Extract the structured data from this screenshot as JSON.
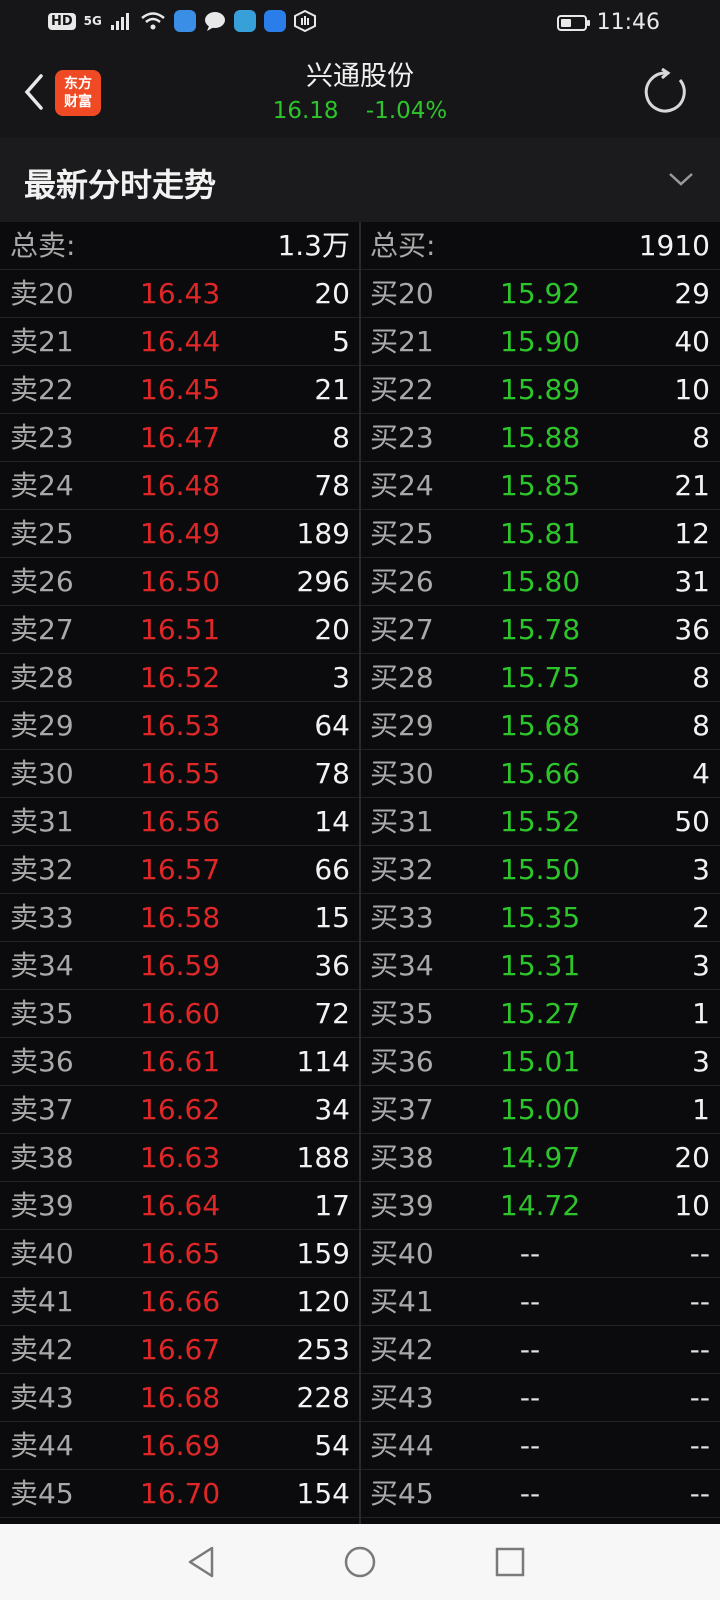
{
  "status_bar": {
    "left_tags": [
      "HD",
      "5G"
    ],
    "icons": [
      "signal-icon",
      "wifi-icon",
      "app-icon-1",
      "message-icon",
      "app-icon-2",
      "cloud-icon",
      "hand-icon"
    ],
    "battery_level": 0.45,
    "time": "11:46"
  },
  "header": {
    "logo_text_line1": "东方",
    "logo_text_line2": "财富",
    "stock_name": "兴通股份",
    "price": "16.18",
    "change": "-1.04%",
    "price_color": "#2ec42c"
  },
  "section": {
    "title": "最新分时走势"
  },
  "book": {
    "total_sell_label": "总卖:",
    "total_sell": "1.3万",
    "total_buy_label": "总买:",
    "total_buy": "1910",
    "sell_color": "#e02727",
    "buy_color": "#2ec42c",
    "rows": [
      {
        "sl": "卖20",
        "sp": "16.43",
        "sv": "20",
        "bl": "买20",
        "bp": "15.92",
        "bv": "29"
      },
      {
        "sl": "卖21",
        "sp": "16.44",
        "sv": "5",
        "bl": "买21",
        "bp": "15.90",
        "bv": "40"
      },
      {
        "sl": "卖22",
        "sp": "16.45",
        "sv": "21",
        "bl": "买22",
        "bp": "15.89",
        "bv": "10"
      },
      {
        "sl": "卖23",
        "sp": "16.47",
        "sv": "8",
        "bl": "买23",
        "bp": "15.88",
        "bv": "8"
      },
      {
        "sl": "卖24",
        "sp": "16.48",
        "sv": "78",
        "bl": "买24",
        "bp": "15.85",
        "bv": "21"
      },
      {
        "sl": "卖25",
        "sp": "16.49",
        "sv": "189",
        "bl": "买25",
        "bp": "15.81",
        "bv": "12"
      },
      {
        "sl": "卖26",
        "sp": "16.50",
        "sv": "296",
        "bl": "买26",
        "bp": "15.80",
        "bv": "31"
      },
      {
        "sl": "卖27",
        "sp": "16.51",
        "sv": "20",
        "bl": "买27",
        "bp": "15.78",
        "bv": "36"
      },
      {
        "sl": "卖28",
        "sp": "16.52",
        "sv": "3",
        "bl": "买28",
        "bp": "15.75",
        "bv": "8"
      },
      {
        "sl": "卖29",
        "sp": "16.53",
        "sv": "64",
        "bl": "买29",
        "bp": "15.68",
        "bv": "8"
      },
      {
        "sl": "卖30",
        "sp": "16.55",
        "sv": "78",
        "bl": "买30",
        "bp": "15.66",
        "bv": "4"
      },
      {
        "sl": "卖31",
        "sp": "16.56",
        "sv": "14",
        "bl": "买31",
        "bp": "15.52",
        "bv": "50"
      },
      {
        "sl": "卖32",
        "sp": "16.57",
        "sv": "66",
        "bl": "买32",
        "bp": "15.50",
        "bv": "3"
      },
      {
        "sl": "卖33",
        "sp": "16.58",
        "sv": "15",
        "bl": "买33",
        "bp": "15.35",
        "bv": "2"
      },
      {
        "sl": "卖34",
        "sp": "16.59",
        "sv": "36",
        "bl": "买34",
        "bp": "15.31",
        "bv": "3"
      },
      {
        "sl": "卖35",
        "sp": "16.60",
        "sv": "72",
        "bl": "买35",
        "bp": "15.27",
        "bv": "1"
      },
      {
        "sl": "卖36",
        "sp": "16.61",
        "sv": "114",
        "bl": "买36",
        "bp": "15.01",
        "bv": "3"
      },
      {
        "sl": "卖37",
        "sp": "16.62",
        "sv": "34",
        "bl": "买37",
        "bp": "15.00",
        "bv": "1"
      },
      {
        "sl": "卖38",
        "sp": "16.63",
        "sv": "188",
        "bl": "买38",
        "bp": "14.97",
        "bv": "20"
      },
      {
        "sl": "卖39",
        "sp": "16.64",
        "sv": "17",
        "bl": "买39",
        "bp": "14.72",
        "bv": "10"
      },
      {
        "sl": "卖40",
        "sp": "16.65",
        "sv": "159",
        "bl": "买40",
        "bp": "--",
        "bv": "--"
      },
      {
        "sl": "卖41",
        "sp": "16.66",
        "sv": "120",
        "bl": "买41",
        "bp": "--",
        "bv": "--"
      },
      {
        "sl": "卖42",
        "sp": "16.67",
        "sv": "253",
        "bl": "买42",
        "bp": "--",
        "bv": "--"
      },
      {
        "sl": "卖43",
        "sp": "16.68",
        "sv": "228",
        "bl": "买43",
        "bp": "--",
        "bv": "--"
      },
      {
        "sl": "卖44",
        "sp": "16.69",
        "sv": "54",
        "bl": "买44",
        "bp": "--",
        "bv": "--"
      },
      {
        "sl": "卖45",
        "sp": "16.70",
        "sv": "154",
        "bl": "买45",
        "bp": "--",
        "bv": "--"
      }
    ]
  },
  "nav_bar": {
    "buttons": [
      "back-nav-icon",
      "home-nav-icon",
      "recents-nav-icon"
    ]
  }
}
